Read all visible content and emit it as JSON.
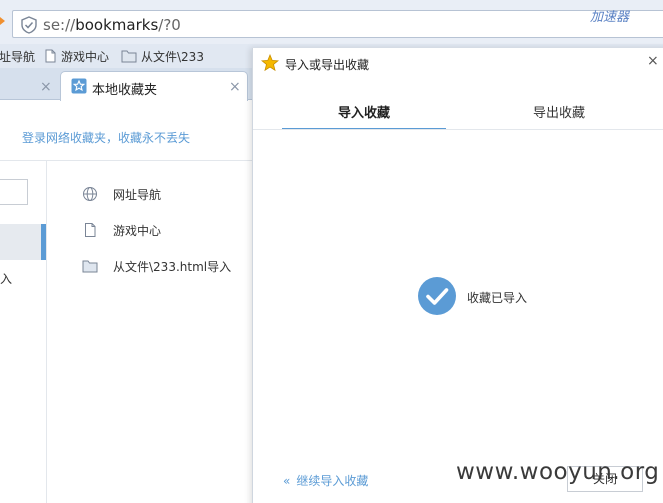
{
  "address_bar": {
    "url_scheme": "se:",
    "url_slashes": "//",
    "url_host": "bookmarks",
    "url_path": "/?0",
    "accelerator_label": "加速器"
  },
  "bookmarks_bar": {
    "items": [
      {
        "label": "址导航",
        "icon": "globe-icon"
      },
      {
        "label": "游戏中心",
        "icon": "page-icon"
      },
      {
        "label": "从文件\\233",
        "icon": "folder-icon"
      }
    ]
  },
  "tabs": [
    {
      "label": "",
      "close": "×"
    },
    {
      "label": "本地收藏夹",
      "close": "×",
      "icon": "star-outline-icon"
    }
  ],
  "page": {
    "login_prompt": "登录网络收藏夹，收藏永不丢失",
    "left_fragment": "入",
    "list": [
      {
        "label": "网址导航",
        "icon": "globe-icon"
      },
      {
        "label": "游戏中心",
        "icon": "page-icon"
      },
      {
        "label": "从文件\\233.html导入",
        "icon": "folder-icon"
      }
    ]
  },
  "dialog": {
    "title": "导入或导出收藏",
    "close_glyph": "×",
    "tabs": [
      {
        "label": "导入收藏",
        "active": true
      },
      {
        "label": "导出收藏",
        "active": false
      }
    ],
    "status_text": "收藏已导入",
    "continue_link": "继续导入收藏",
    "close_button": "关闭"
  },
  "watermark": "www.wooyun.org",
  "colors": {
    "accent": "#5b9bd5",
    "link": "#5b9bd5",
    "star": "#f5b800"
  }
}
